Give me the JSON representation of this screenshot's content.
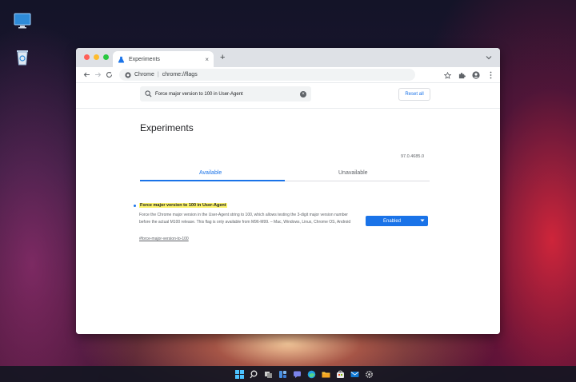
{
  "desktop": {
    "icons": [
      "monitor-icon",
      "recycle-bin-icon"
    ],
    "accent": "#1a73e8"
  },
  "browser": {
    "tab_title": "Experiments",
    "tab_close": "×",
    "new_tab": "+",
    "address": {
      "site": "Chrome",
      "separator": "|",
      "url": "chrome://flags"
    }
  },
  "flags_page": {
    "search_value": "Force major version to 100 in User-Agent",
    "reset_label": "Reset all",
    "title": "Experiments",
    "version": "97.0.4685.0",
    "tabs": {
      "available": "Available",
      "unavailable": "Unavailable"
    },
    "flag": {
      "name": "Force major version to 100 in User-Agent",
      "description": "Force the Chrome major version in the User-Agent string to 100, which allows testing the 3-digit major version number before the actual M100 release. This flag is only available from M96-M99. – Mac, Windows, Linux, Chrome OS, Android",
      "link": "#force-major-version-to-100",
      "selected_value": "Enabled",
      "selected_color": "#1a73e8"
    }
  },
  "taskbar": {
    "apps": [
      "windows-start-icon",
      "search-icon",
      "task-view-icon",
      "widgets-icon",
      "chat-icon",
      "edge-icon",
      "file-explorer-icon",
      "store-icon",
      "mail-icon",
      "settings-icon"
    ]
  }
}
